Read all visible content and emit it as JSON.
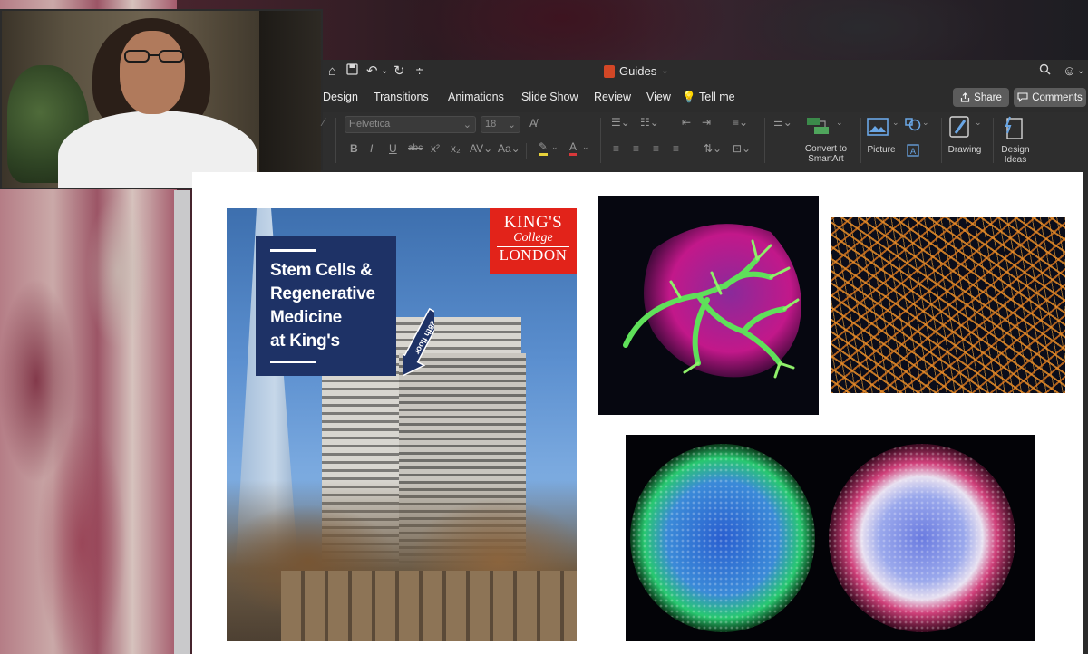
{
  "window": {
    "doc_title": "Guides",
    "title_chevron": "⌄"
  },
  "tabs": [
    "Design",
    "Transitions",
    "Animations",
    "Slide Show",
    "Review",
    "View"
  ],
  "tell_me": "Tell me",
  "share_label": "Share",
  "comments_label": "Comments",
  "ribbon": {
    "font_name": "Helvetica",
    "font_size": "18",
    "convert_label_1": "Convert to",
    "convert_label_2": "SmartArt",
    "picture_label": "Picture",
    "drawing_label": "Drawing",
    "design_ideas_1": "Design",
    "design_ideas_2": "Ideas",
    "format_buttons": [
      "B",
      "I",
      "U",
      "abc",
      "x²",
      "x₂"
    ]
  },
  "poster": {
    "logo_line1": "KING'S",
    "logo_line2": "College",
    "logo_line3": "LONDON",
    "title_lines": [
      "Stem Cells &",
      "Regenerative",
      "Medicine",
      "at King's"
    ],
    "floor_label": "28th floor"
  },
  "colors": {
    "kcl_red": "#e2231a",
    "poster_navy": "#1e3266",
    "accent_green": "#2ee04a",
    "accent_magenta": "#c2188a"
  }
}
